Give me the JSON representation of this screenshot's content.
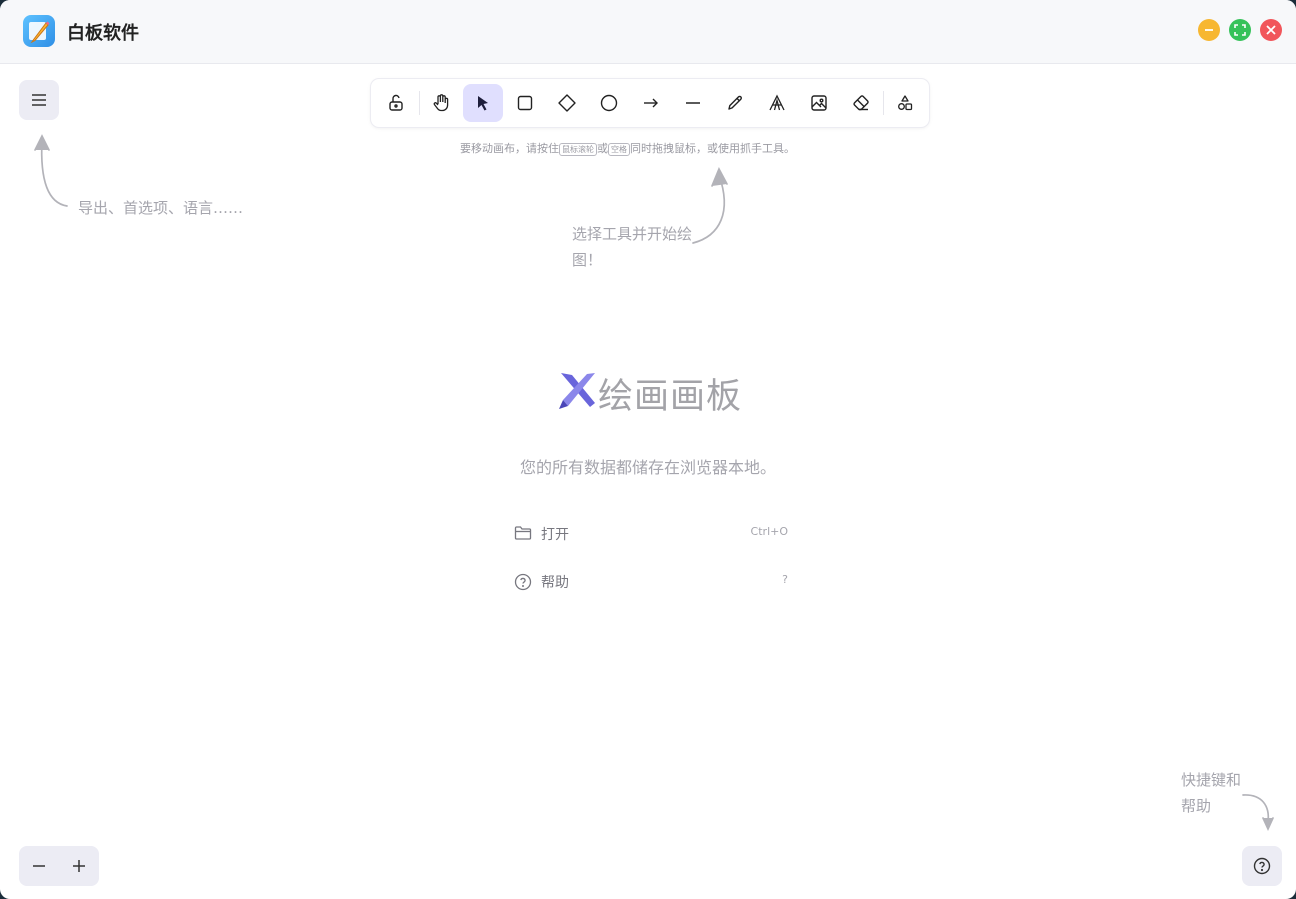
{
  "app": {
    "title": "白板软件",
    "icon": "pencil-note-icon"
  },
  "window_controls": [
    {
      "name": "minimize-button",
      "color": "#f7b731"
    },
    {
      "name": "maximize-button",
      "color": "#36c25a"
    },
    {
      "name": "close-button",
      "color": "#f1555a"
    }
  ],
  "toolbar": {
    "tools": [
      {
        "name": "lock",
        "icon": "unlock-icon"
      },
      {
        "name": "hand",
        "icon": "hand-icon"
      },
      {
        "name": "selection",
        "icon": "pointer-icon",
        "active": true
      },
      {
        "name": "rectangle",
        "icon": "square-icon"
      },
      {
        "name": "diamond",
        "icon": "diamond-icon"
      },
      {
        "name": "ellipse",
        "icon": "circle-icon"
      },
      {
        "name": "arrow",
        "icon": "arrow-right-icon"
      },
      {
        "name": "line",
        "icon": "line-icon"
      },
      {
        "name": "freedraw",
        "icon": "pencil-icon"
      },
      {
        "name": "text",
        "icon": "text-icon"
      },
      {
        "name": "image",
        "icon": "image-icon"
      },
      {
        "name": "eraser",
        "icon": "eraser-icon"
      },
      {
        "name": "more-shapes",
        "icon": "shapes-icon"
      }
    ],
    "accent": "#e0dffe"
  },
  "hints": {
    "canvas_move_prefix": "要移动画布，请按住",
    "key_wheel": "鼠标滚轮",
    "or": "或",
    "key_space": "空格",
    "canvas_move_suffix": "同时拖拽鼠标，或使用抓手工具。",
    "menu_hint": "导出、首选项、语言……",
    "tool_hint": "选择工具并开始绘图！",
    "shortcut_hint": "快捷键和帮助"
  },
  "welcome": {
    "logo_text": "绘画画板",
    "storage_note": "您的所有数据都储存在浏览器本地。",
    "items": [
      {
        "label": "打开",
        "shortcut": "Ctrl+O",
        "icon": "folder-icon"
      },
      {
        "label": "帮助",
        "shortcut": "?",
        "icon": "help-circle-icon"
      }
    ],
    "brand_color": "#6965db"
  },
  "zoom": {
    "out_icon": "minus-icon",
    "in_icon": "plus-icon"
  },
  "help_button": {
    "icon": "help-circle-icon"
  }
}
